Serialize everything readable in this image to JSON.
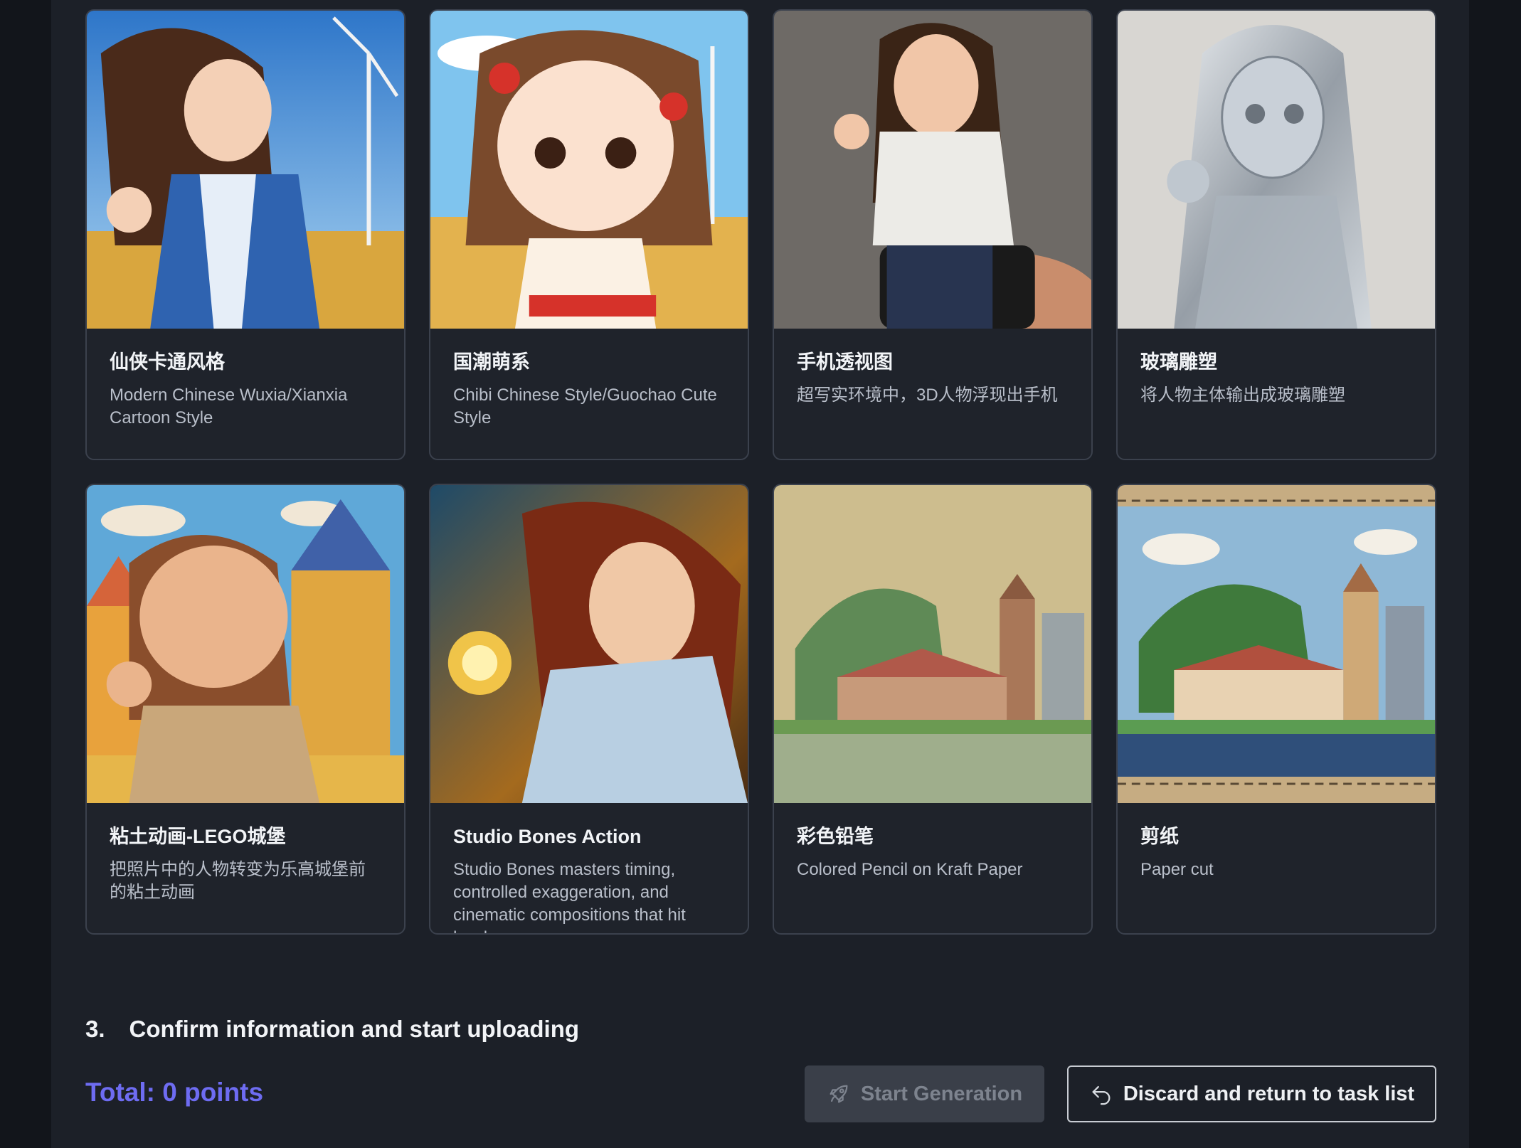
{
  "styles": [
    {
      "title": "仙侠卡通风格",
      "desc": "Modern Chinese Wuxia/Xianxia Cartoon Style"
    },
    {
      "title": "国潮萌系",
      "desc": "Chibi Chinese Style/Guochao Cute Style"
    },
    {
      "title": "手机透视图",
      "desc": "超写实环境中，3D人物浮现出手机"
    },
    {
      "title": "玻璃雕塑",
      "desc": "将人物主体输出成玻璃雕塑"
    },
    {
      "title": "粘土动画-LEGO城堡",
      "desc": "把照片中的人物转变为乐高城堡前的粘土动画"
    },
    {
      "title": "Studio Bones Action",
      "desc": "Studio Bones masters timing, controlled exaggeration, and cinematic compositions that hit hard."
    },
    {
      "title": "彩色铅笔",
      "desc": "Colored Pencil on Kraft Paper"
    },
    {
      "title": "剪纸",
      "desc": "Paper cut"
    }
  ],
  "step": {
    "number": "3.",
    "label": "Confirm information and start uploading"
  },
  "total": "Total: 0 points",
  "buttons": {
    "start": "Start Generation",
    "discard": "Discard and return to task list"
  },
  "icons": {
    "start": "rocket-icon",
    "discard": "return-arrow-icon"
  },
  "colors": {
    "accent": "#6e6cf2",
    "background": "#1c2028",
    "card": "#1f232b"
  }
}
